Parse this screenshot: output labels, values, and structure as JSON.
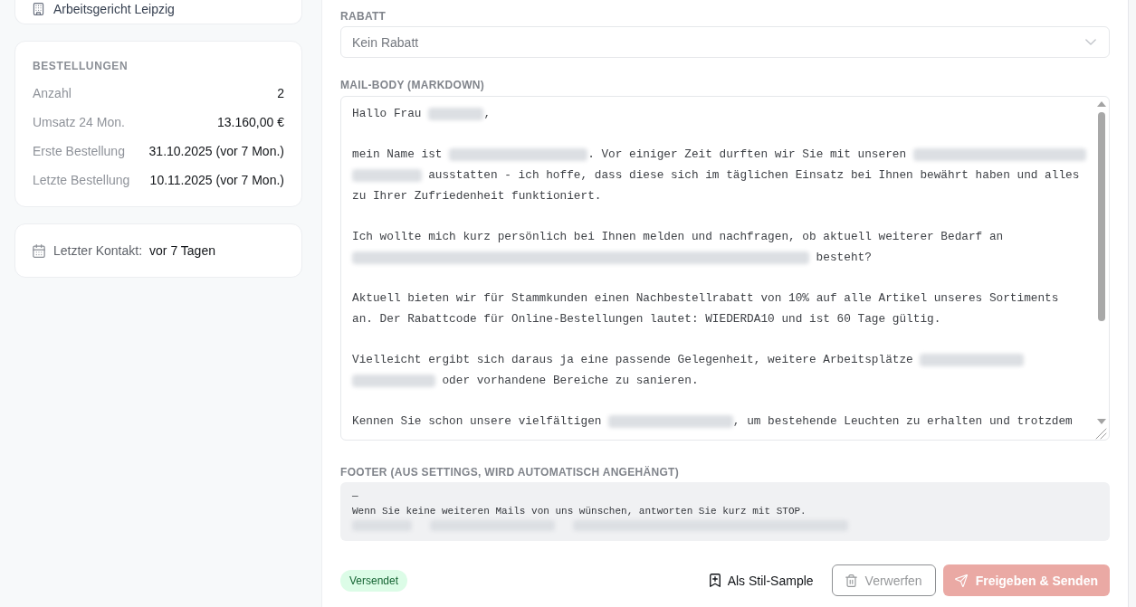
{
  "sidebar": {
    "location": {
      "text": "Arbeitsgericht Leipzig"
    },
    "orders": {
      "heading": "BESTELLUNGEN",
      "rows": [
        {
          "label": "Anzahl",
          "value": "2"
        },
        {
          "label": "Umsatz 24 Mon.",
          "value": "13.160,00 €"
        },
        {
          "label": "Erste Bestellung",
          "value": "31.10.2025 (vor 7 Mon.)"
        },
        {
          "label": "Letzte Bestellung",
          "value": "10.11.2025 (vor 7 Mon.)"
        }
      ]
    },
    "last_contact": {
      "label": "Letzter Kontakt:",
      "value": "vor 7 Tagen"
    }
  },
  "form": {
    "discount": {
      "label": "RABATT",
      "value": "Kein Rabatt"
    },
    "mail_body": {
      "label": "MAIL-BODY (MARKDOWN)",
      "paragraphs": [
        {
          "lines": [
            [
              {
                "kind": "text",
                "text": "Hallo Frau "
              },
              {
                "kind": "redacted"
              },
              {
                "kind": "text",
                "text": ","
              }
            ]
          ]
        },
        {
          "lines": [
            [
              {
                "kind": "text",
                "text": "mein Name ist "
              },
              {
                "kind": "redacted"
              },
              {
                "kind": "text",
                "text": ". Vor einiger Zeit durften wir Sie mit unseren "
              },
              {
                "kind": "redacted"
              }
            ],
            [
              {
                "kind": "redacted"
              },
              {
                "kind": "text",
                "text": " ausstatten - ich hoffe, dass diese sich im täglichen Einsatz bei Ihnen bewährt haben und alles"
              }
            ],
            [
              {
                "kind": "text",
                "text": "zu Ihrer Zufriedenheit funktioniert."
              }
            ]
          ]
        },
        {
          "lines": [
            [
              {
                "kind": "text",
                "text": "Ich wollte mich kurz persönlich bei Ihnen melden und nachfragen, ob aktuell weiterer Bedarf an"
              }
            ],
            [
              {
                "kind": "redacted"
              },
              {
                "kind": "text",
                "text": " besteht?"
              }
            ]
          ]
        },
        {
          "lines": [
            [
              {
                "kind": "text",
                "text": "Aktuell bieten wir für Stammkunden einen Nachbestellrabatt von 10% auf alle Artikel unseres Sortiments"
              }
            ],
            [
              {
                "kind": "text",
                "text": "an. Der Rabattcode für Online-Bestellungen lautet: WIEDERDA10 und ist 60 Tage gültig."
              }
            ]
          ]
        },
        {
          "lines": [
            [
              {
                "kind": "text",
                "text": "Vielleicht ergibt sich daraus ja eine passende Gelegenheit, weitere Arbeitsplätze "
              },
              {
                "kind": "redacted"
              }
            ],
            [
              {
                "kind": "redacted"
              },
              {
                "kind": "text",
                "text": " oder vorhandene Bereiche zu sanieren."
              }
            ]
          ]
        },
        {
          "lines": [
            [
              {
                "kind": "text",
                "text": "Kennen Sie schon unsere vielfältigen "
              },
              {
                "kind": "redacted"
              },
              {
                "kind": "text",
                "text": ", um bestehende Leuchten zu erhalten und trotzdem"
              }
            ]
          ]
        }
      ]
    },
    "footer": {
      "label": "FOOTER (AUS SETTINGS, WIRD AUTOMATISCH ANGEHÄNGT)",
      "lines": [
        {
          "kind": "text",
          "text": "—"
        },
        {
          "kind": "text",
          "text": "Wenn Sie keine weiteren Mails von uns wünschen, antworten Sie kurz mit STOP."
        },
        {
          "kind": "redacted"
        }
      ]
    }
  },
  "action_bar": {
    "status": "Versendet",
    "actions": [
      {
        "kind": "ghost",
        "label": "Als Stil-Sample",
        "disabled": false
      },
      {
        "kind": "outline",
        "label": "Verwerfen",
        "disabled": true
      },
      {
        "kind": "primary",
        "label": "Freigeben & Senden",
        "disabled": true
      }
    ]
  }
}
